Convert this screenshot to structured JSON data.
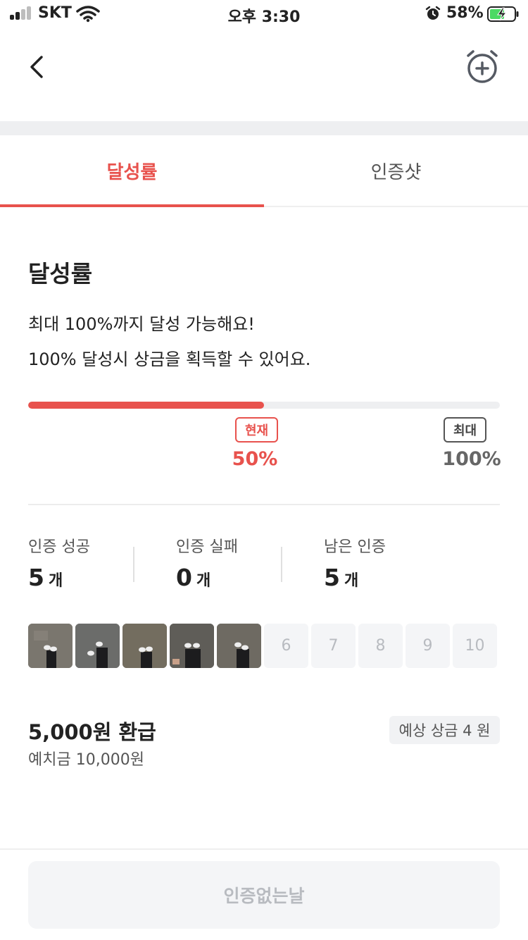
{
  "status_bar": {
    "carrier": "SKT",
    "time": "오후 3:30",
    "battery_percent": "58%",
    "signal_bars_active": 2,
    "signal_bars_total": 4,
    "icons": [
      "signal-icon",
      "wifi-icon",
      "alarm-icon",
      "battery-charging-icon"
    ]
  },
  "header": {
    "back_icon": "chevron-left-icon",
    "action_icon": "alarm-add-icon"
  },
  "tabs": [
    {
      "label": "달성률",
      "active": true
    },
    {
      "label": "인증샷",
      "active": false
    }
  ],
  "achievement": {
    "title": "달성률",
    "description_line1": "최대 100%까지 달성 가능해요!",
    "description_line2": "100% 달성시 상금을 획득할 수 있어요.",
    "progress_fraction": 0.5,
    "current_tag": "현재",
    "current_value": "50%",
    "max_tag": "최대",
    "max_value": "100%"
  },
  "stats": [
    {
      "label": "인증 성공",
      "value": "5",
      "unit": "개"
    },
    {
      "label": "인증 실패",
      "value": "0",
      "unit": "개"
    },
    {
      "label": "남은 인증",
      "value": "5",
      "unit": "개"
    }
  ],
  "shots": {
    "photos_count": 5,
    "empty_slots": [
      "6",
      "7",
      "8",
      "9",
      "10"
    ]
  },
  "refund": {
    "amount_text": "5,000원 환급",
    "deposit_text": "예치금 10,000원",
    "expected_prize": "예상 상금 4 원"
  },
  "cta": {
    "label": "인증없는날"
  },
  "colors": {
    "accent": "#e8524d",
    "muted": "#b8bbc0",
    "surface": "#f4f5f7"
  }
}
